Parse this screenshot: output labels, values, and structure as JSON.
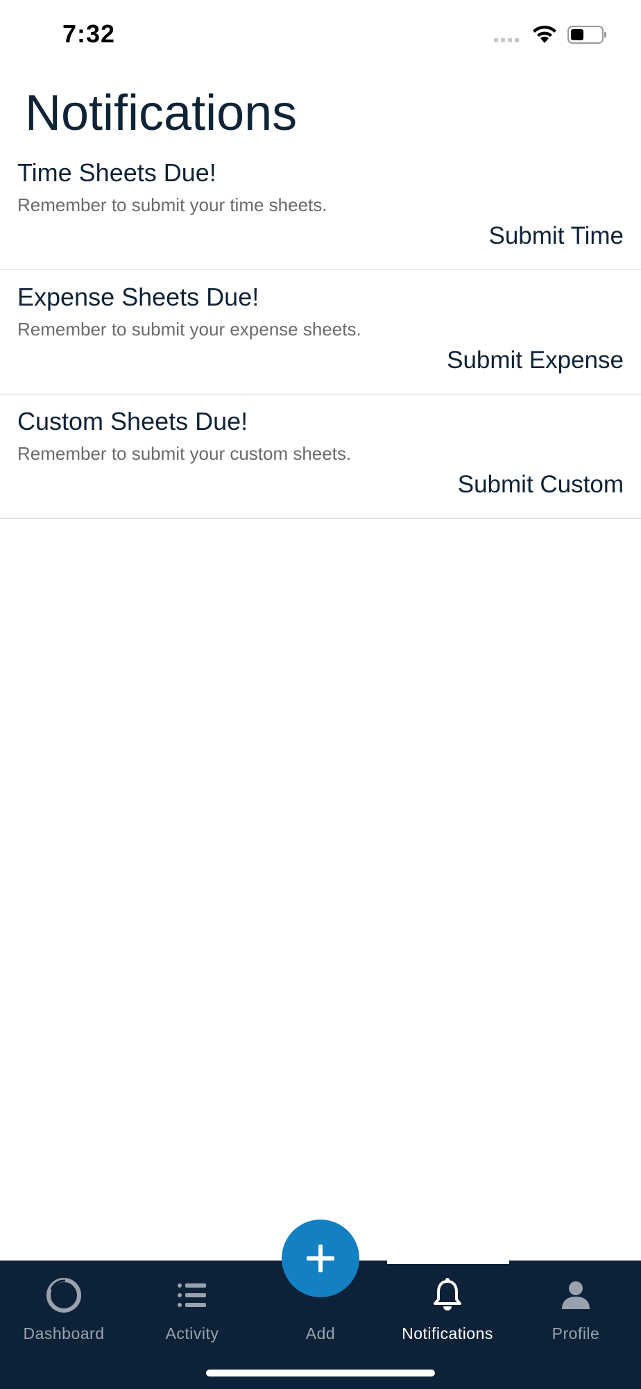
{
  "status_bar": {
    "time": "7:32"
  },
  "page": {
    "title": "Notifications"
  },
  "notifications": [
    {
      "title": "Time Sheets Due!",
      "body": "Remember to submit your time sheets.",
      "action": "Submit Time"
    },
    {
      "title": "Expense Sheets Due!",
      "body": "Remember to submit your expense sheets.",
      "action": "Submit Expense"
    },
    {
      "title": "Custom Sheets Due!",
      "body": "Remember to submit your custom sheets.",
      "action": "Submit Custom"
    }
  ],
  "tab_bar": {
    "tabs": [
      {
        "label": "Dashboard",
        "icon": "dashboard-ring-icon"
      },
      {
        "label": "Activity",
        "icon": "list-icon"
      },
      {
        "label": "Add",
        "icon": "plus-icon"
      },
      {
        "label": "Notifications",
        "icon": "bell-icon",
        "active": true
      },
      {
        "label": "Profile",
        "icon": "person-icon"
      }
    ]
  },
  "colors": {
    "tab_bar_bg": "#0d2238",
    "accent": "#1380c4",
    "title_text": "#0f2337",
    "inactive_tab": "#9aa3ad"
  }
}
